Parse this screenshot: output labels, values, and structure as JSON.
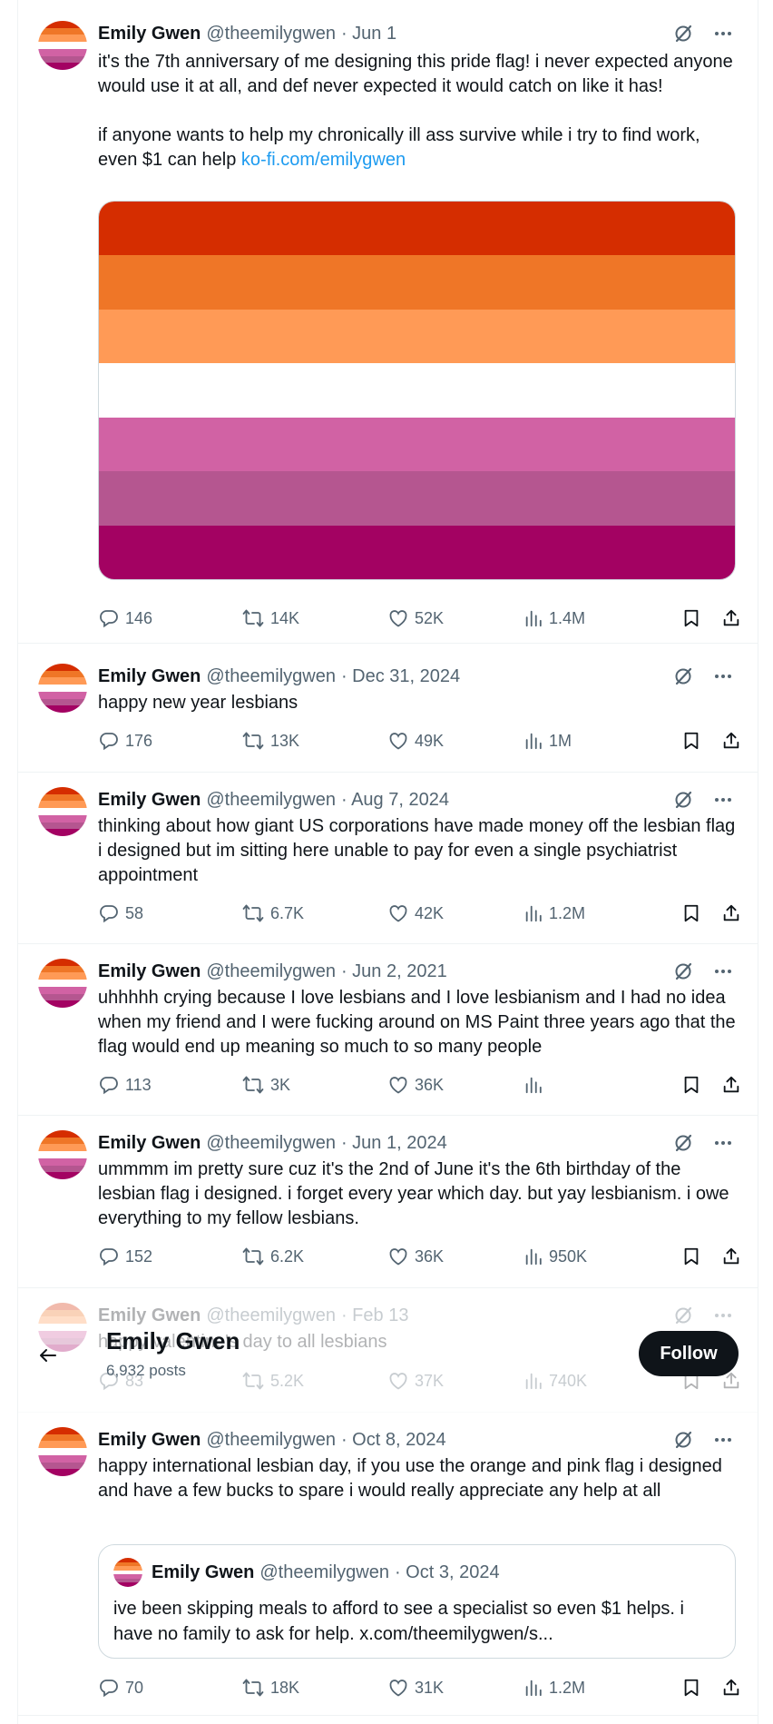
{
  "author": {
    "name": "Emily Gwen",
    "handle": "@theemilygwen"
  },
  "flag_colors": [
    "#D52D00",
    "#EF7627",
    "#FF9A56",
    "#FFFFFF",
    "#D162A4",
    "#B55690",
    "#A30262"
  ],
  "icons": {
    "reply": "reply-icon",
    "retweet": "retweet-icon",
    "like": "heart-icon",
    "views": "views-icon",
    "bookmark": "bookmark-icon",
    "share": "share-icon",
    "grok": "grok-icon",
    "more": "more-icon",
    "back": "back-arrow-icon"
  },
  "tweets": [
    {
      "date": "· Jun 1",
      "text": "it's the 7th anniversary of me designing this pride flag! i never expected anyone would use it at all, and def never expected it would catch on like it has!\n\nif anyone wants to help my chronically ill ass survive while i try to find work, even $1 can help ",
      "link": "ko-fi.com/emilygwen",
      "replies": "146",
      "reposts": "14K",
      "likes": "52K",
      "views": "1.4M"
    },
    {
      "date": "· Dec 31, 2024",
      "text": "happy new year lesbians",
      "replies": "176",
      "reposts": "13K",
      "likes": "49K",
      "views": "1M"
    },
    {
      "date": "· Aug 7, 2024",
      "text": "thinking about how giant US corporations have made money off the lesbian flag i designed but im sitting here unable to pay for even a single psychiatrist appointment",
      "replies": "58",
      "reposts": "6.7K",
      "likes": "42K",
      "views": "1.2M"
    },
    {
      "date": "· Jun 2, 2021",
      "text": "uhhhhh crying because I love lesbians and I love lesbianism and I had no idea when my friend and I were fucking around on MS Paint three years ago that the flag would end up meaning so much to so many people",
      "replies": "113",
      "reposts": "3K",
      "likes": "36K",
      "views": ""
    },
    {
      "date": "· Jun 1, 2024",
      "text": "ummmm im pretty sure cuz it's the 2nd of June it's the 6th birthday of the lesbian flag i designed. i forget every year which day. but yay lesbianism. i owe everything to my fellow lesbians.",
      "replies": "152",
      "reposts": "6.2K",
      "likes": "36K",
      "views": "950K"
    },
    {
      "date": "· Feb 13",
      "text": "happy valentine's day to all lesbians",
      "replies": "83",
      "reposts": "5.2K",
      "likes": "37K",
      "views": "740K"
    },
    {
      "date": "· Oct 8, 2024",
      "text": "happy international lesbian day, if you use the orange and pink flag i designed and have a few bucks to spare i would really appreciate any help at all",
      "replies": "70",
      "reposts": "18K",
      "likes": "31K",
      "views": "1.2M",
      "quote": {
        "date": "· Oct 3, 2024",
        "text": "ive been skipping meals to afford to see a specialist so even $1 helps. i have no family to ask for help. x.com/theemilygwen/s..."
      }
    }
  ],
  "profile_header": {
    "name": "Emily Gwen",
    "posts_count": "6,932 posts",
    "follow_label": "Follow"
  }
}
